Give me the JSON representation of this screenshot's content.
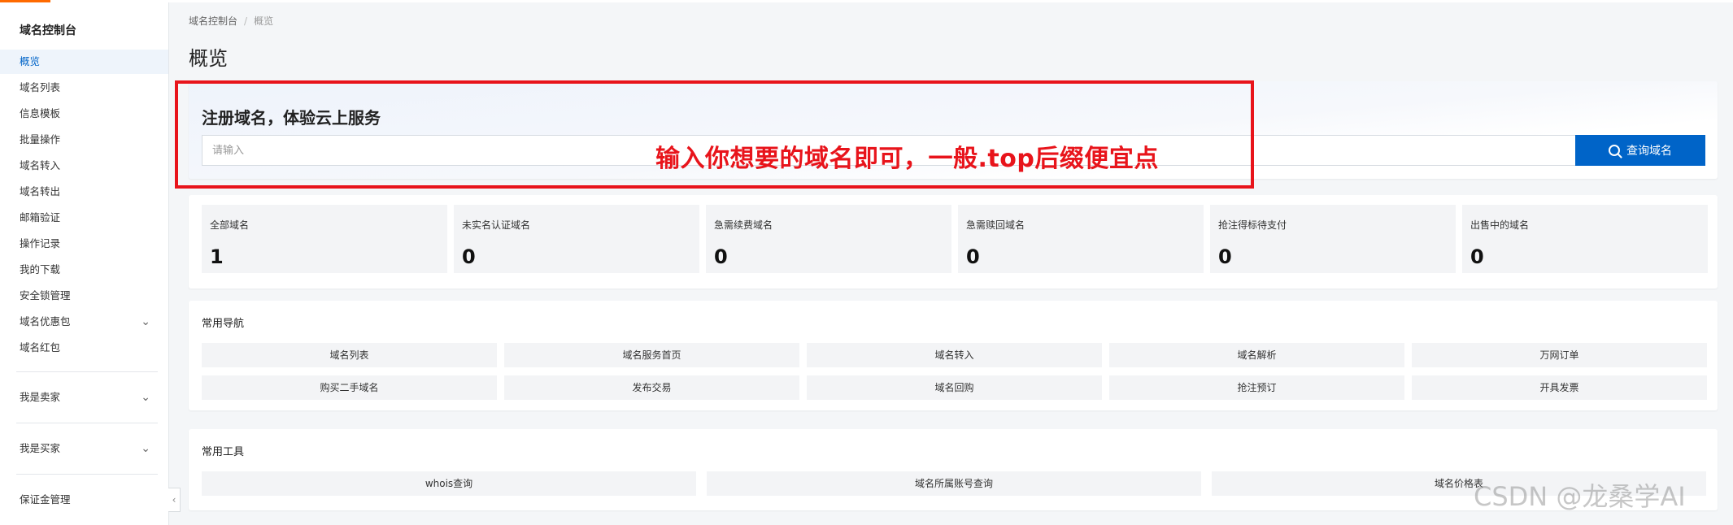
{
  "sidebar": {
    "title": "域名控制台",
    "items": [
      {
        "label": "概览"
      },
      {
        "label": "域名列表"
      },
      {
        "label": "信息模板"
      },
      {
        "label": "批量操作"
      },
      {
        "label": "域名转入"
      },
      {
        "label": "域名转出"
      },
      {
        "label": "邮箱验证"
      },
      {
        "label": "操作记录"
      },
      {
        "label": "我的下载"
      },
      {
        "label": "安全锁管理"
      },
      {
        "label": "域名优惠包"
      },
      {
        "label": "域名红包"
      }
    ],
    "groups": [
      {
        "label": "我是卖家"
      },
      {
        "label": "我是买家"
      }
    ],
    "bottom_item": "保证金管理",
    "collapse_icon": "‹",
    "chevron_icon": "⌄"
  },
  "breadcrumb": {
    "root": "域名控制台",
    "separator": "/",
    "current": "概览"
  },
  "page_title": "概览",
  "register": {
    "title": "注册域名，体验云上服务",
    "input_placeholder": "请输入",
    "search_button": "查询域名"
  },
  "annotation": {
    "text": "输入你想要的域名即可，一般.top后缀便宜点",
    "color": "#e8141b"
  },
  "stats": [
    {
      "label": "全部域名",
      "value": "1"
    },
    {
      "label": "未实名认证域名",
      "value": "0"
    },
    {
      "label": "急需续费域名",
      "value": "0"
    },
    {
      "label": "急需赎回域名",
      "value": "0"
    },
    {
      "label": "抢注得标待支付",
      "value": "0"
    },
    {
      "label": "出售中的域名",
      "value": "0"
    }
  ],
  "common_nav": {
    "title": "常用导航",
    "items": [
      "域名列表",
      "域名服务首页",
      "域名转入",
      "域名解析",
      "万网订单",
      "购买二手域名",
      "发布交易",
      "域名回购",
      "抢注预订",
      "开具发票"
    ]
  },
  "common_tools": {
    "title": "常用工具",
    "items": [
      "whois查询",
      "域名所属账号查询",
      "域名价格表"
    ]
  },
  "watermark": "CSDN @龙桑学AI",
  "colors": {
    "primary": "#0064c8",
    "accent": "#ff6a00",
    "annotation": "#e8141b"
  }
}
